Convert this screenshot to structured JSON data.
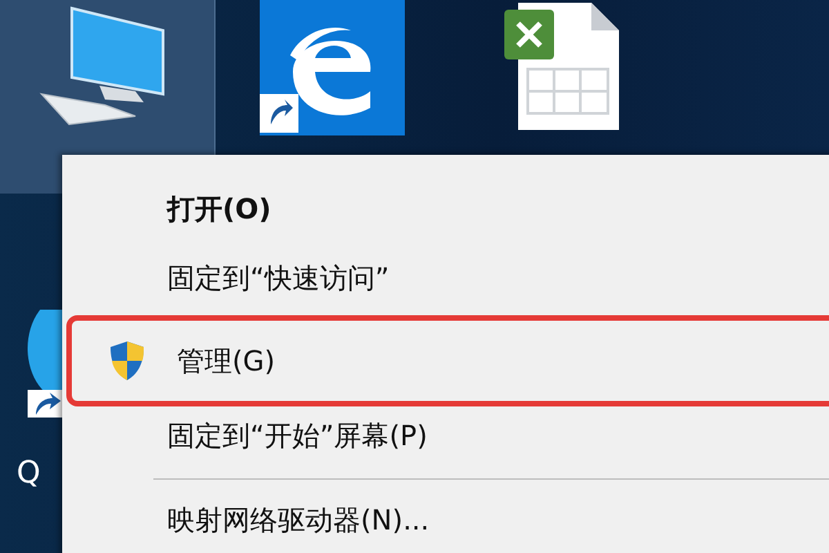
{
  "desktop": {
    "icons": [
      {
        "kind": "computer",
        "selected": true
      },
      {
        "kind": "edge",
        "selected": false
      },
      {
        "kind": "excel",
        "selected": false
      },
      {
        "kind": "qq",
        "selected": false,
        "label": "Q"
      }
    ]
  },
  "context_menu": {
    "items": [
      {
        "label": "打开(O)",
        "bold": true,
        "kind": "text",
        "highlighted": false
      },
      {
        "label": "固定到“快速访问”",
        "bold": false,
        "kind": "text",
        "highlighted": false
      },
      {
        "label": "管理(G)",
        "bold": false,
        "kind": "shield",
        "highlighted": true
      },
      {
        "label": "固定到“开始”屏幕(P)",
        "bold": false,
        "kind": "text",
        "highlighted": false
      },
      {
        "kind": "separator"
      },
      {
        "label": "映射网络驱动器(N)...",
        "bold": false,
        "kind": "text",
        "highlighted": false
      }
    ]
  }
}
